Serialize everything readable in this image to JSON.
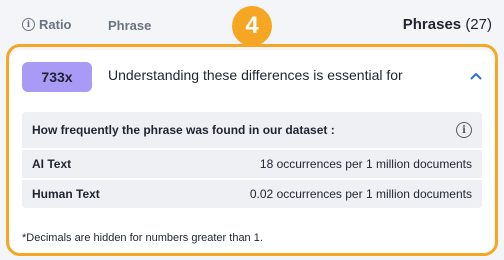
{
  "header": {
    "ratio_label": "Ratio",
    "phrase_label": "Phrase",
    "count_title": "Phrases",
    "count_value": "(27)"
  },
  "step_badge": "4",
  "phrase_item": {
    "ratio": "733x",
    "text": "Understanding these differences is essential for",
    "stats_heading": "How frequently the phrase was found in our dataset :",
    "rows": [
      {
        "label": "AI Text",
        "value": "18 occurrences per 1 million documents"
      },
      {
        "label": "Human Text",
        "value": "0.02 occurrences per 1 million documents"
      }
    ],
    "footnote": "*Decimals are hidden for numbers greater than 1."
  },
  "colors": {
    "highlight": "#f5a623",
    "ratio_pill": "#a99bf5",
    "chevron": "#2f6fdb"
  },
  "icons": {
    "header_info": "info-icon",
    "stats_info": "info-icon",
    "collapse": "chevron-up-icon"
  }
}
